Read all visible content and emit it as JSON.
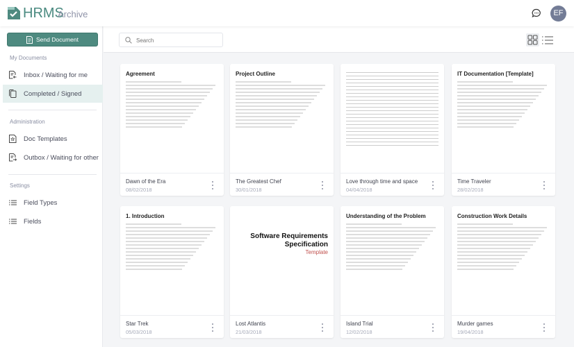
{
  "header": {
    "brand": "HRMS",
    "subtitle": "Archive",
    "avatar_initials": "EF"
  },
  "sidebar": {
    "send_label": "Send Document",
    "sections": [
      {
        "label": "My Documents",
        "items": [
          {
            "label": "Inbox / Waiting for me",
            "icon": "inbox-doc-icon"
          },
          {
            "label": "Completed / Signed",
            "icon": "copy-doc-icon",
            "active": true
          }
        ]
      },
      {
        "label": "Administration",
        "items": [
          {
            "label": "Doc Templates",
            "icon": "template-doc-icon"
          },
          {
            "label": "Outbox / Waiting for other",
            "icon": "outbox-doc-icon"
          }
        ]
      },
      {
        "label": "Settings",
        "items": [
          {
            "label": "Field Types",
            "icon": "list-icon"
          },
          {
            "label": "Fields",
            "icon": "list-icon"
          }
        ]
      }
    ]
  },
  "search": {
    "placeholder": "Search"
  },
  "colors": {
    "accent": "#4e8a80",
    "active_bg": "#e5f0ef",
    "avatar": "#737c96"
  },
  "documents": [
    {
      "title": "Dawn of the Era",
      "date": "08/02/2018",
      "heading": "Agreement"
    },
    {
      "title": "The Greatest Chef",
      "date": "30/01/2018",
      "heading": "Project Outline"
    },
    {
      "title": "Love through time and space",
      "date": "04/04/2018",
      "heading": ""
    },
    {
      "title": "Time Traveler",
      "date": "28/02/2018",
      "heading": "IT Documentation [Template]"
    },
    {
      "title": "Star Trek",
      "date": "05/03/2018",
      "heading": "1. Introduction"
    },
    {
      "title": "Lost Atlantis",
      "date": "21/03/2018",
      "heading": "Software Requirements Specification",
      "subheading": "Template"
    },
    {
      "title": "Island Trial",
      "date": "12/02/2018",
      "heading": "Understanding of the Problem"
    },
    {
      "title": "Murder games",
      "date": "19/04/2018",
      "heading": "Construction Work Details"
    }
  ]
}
